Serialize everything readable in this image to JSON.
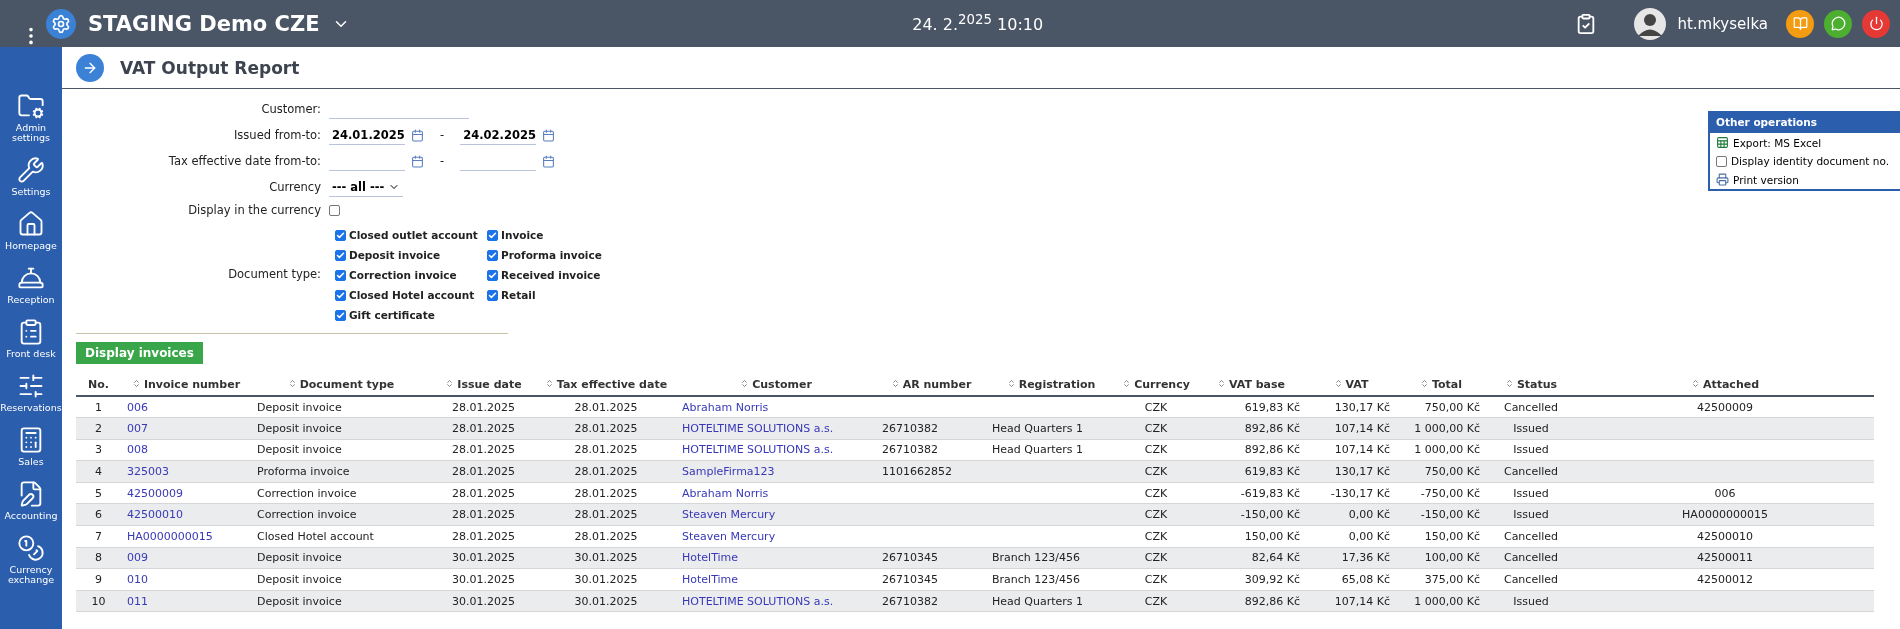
{
  "topbar": {
    "title": "STAGING Demo CZE",
    "datetime": "24. 2.$^{2025}$ 10:10",
    "user": "ht.mkyselka"
  },
  "sidebar": {
    "items": [
      {
        "label": "Admin settings"
      },
      {
        "label": "Settings"
      },
      {
        "label": "Homepage"
      },
      {
        "label": "Reception"
      },
      {
        "label": "Front desk"
      },
      {
        "label": "Reservations"
      },
      {
        "label": "Sales"
      },
      {
        "label": "Accounting"
      },
      {
        "label": "Currency exchange"
      }
    ]
  },
  "page": {
    "title": "VAT Output Report"
  },
  "form": {
    "customer_label": "Customer:",
    "issued_label": "Issued from-to:",
    "issued_from": "24.01.2025",
    "issued_to": "24.02.2025",
    "dash": "-",
    "tax_label": "Tax effective date from-to:",
    "currency_label": "Currency",
    "currency_value": "--- all ---",
    "display_currency_label": "Display in the currency",
    "display_currency_checked": false,
    "doc_type_label": "Document type:",
    "doc_types": [
      {
        "label": "Closed outlet account",
        "checked": true
      },
      {
        "label": "Invoice",
        "checked": true
      },
      {
        "label": "Deposit invoice",
        "checked": true
      },
      {
        "label": "Proforma invoice",
        "checked": true
      },
      {
        "label": "Correction invoice",
        "checked": true
      },
      {
        "label": "Received invoice",
        "checked": true
      },
      {
        "label": "Closed Hotel account",
        "checked": true
      },
      {
        "label": "Retail",
        "checked": true
      },
      {
        "label": "Gift certificate",
        "checked": true
      }
    ],
    "submit": "Display invoices"
  },
  "other_operations": {
    "title": "Other operations",
    "export": "Export: MS Excel",
    "identity_label": "Display identity document no.",
    "identity_checked": false,
    "print": "Print version"
  },
  "table": {
    "columns": [
      {
        "label": "No.",
        "sortable": false
      },
      {
        "label": "Invoice number",
        "sortable": true
      },
      {
        "label": "Document type",
        "sortable": true
      },
      {
        "label": "Issue date",
        "sortable": true
      },
      {
        "label": "Tax effective date",
        "sortable": true
      },
      {
        "label": "Customer",
        "sortable": true
      },
      {
        "label": "AR number",
        "sortable": true
      },
      {
        "label": "Registration",
        "sortable": true
      },
      {
        "label": "Currency",
        "sortable": true
      },
      {
        "label": "VAT base",
        "sortable": true
      },
      {
        "label": "VAT",
        "sortable": true
      },
      {
        "label": "Total",
        "sortable": true
      },
      {
        "label": "Status",
        "sortable": true
      },
      {
        "label": "Attached",
        "sortable": true
      }
    ],
    "rows": [
      [
        "1",
        "006",
        "Deposit invoice",
        "28.01.2025",
        "28.01.2025",
        "Abraham Norris",
        "",
        "",
        "CZK",
        "619,83 Kč",
        "130,17 Kč",
        "750,00 Kč",
        "Cancelled",
        "42500009"
      ],
      [
        "2",
        "007",
        "Deposit invoice",
        "28.01.2025",
        "28.01.2025",
        "HOTELTIME SOLUTIONS a.s.",
        "26710382",
        "Head Quarters 1",
        "CZK",
        "892,86 Kč",
        "107,14 Kč",
        "1 000,00 Kč",
        "Issued",
        ""
      ],
      [
        "3",
        "008",
        "Deposit invoice",
        "28.01.2025",
        "28.01.2025",
        "HOTELTIME SOLUTIONS a.s.",
        "26710382",
        "Head Quarters 1",
        "CZK",
        "892,86 Kč",
        "107,14 Kč",
        "1 000,00 Kč",
        "Issued",
        ""
      ],
      [
        "4",
        "325003",
        "Proforma invoice",
        "28.01.2025",
        "28.01.2025",
        "SampleFirma123",
        "1101662852",
        "",
        "CZK",
        "619,83 Kč",
        "130,17 Kč",
        "750,00 Kč",
        "Cancelled",
        ""
      ],
      [
        "5",
        "42500009",
        "Correction invoice",
        "28.01.2025",
        "28.01.2025",
        "Abraham Norris",
        "",
        "",
        "CZK",
        "-619,83 Kč",
        "-130,17 Kč",
        "-750,00 Kč",
        "Issued",
        "006"
      ],
      [
        "6",
        "42500010",
        "Correction invoice",
        "28.01.2025",
        "28.01.2025",
        "Steaven Mercury",
        "",
        "",
        "CZK",
        "-150,00 Kč",
        "0,00 Kč",
        "-150,00 Kč",
        "Issued",
        "HA0000000015"
      ],
      [
        "7",
        "HA0000000015",
        "Closed Hotel account",
        "28.01.2025",
        "28.01.2025",
        "Steaven Mercury",
        "",
        "",
        "CZK",
        "150,00 Kč",
        "0,00 Kč",
        "150,00 Kč",
        "Cancelled",
        "42500010"
      ],
      [
        "8",
        "009",
        "Deposit invoice",
        "30.01.2025",
        "30.01.2025",
        "HotelTime",
        "26710345",
        "Branch 123/456",
        "CZK",
        "82,64 Kč",
        "17,36 Kč",
        "100,00 Kč",
        "Cancelled",
        "42500011"
      ],
      [
        "9",
        "010",
        "Deposit invoice",
        "30.01.2025",
        "30.01.2025",
        "HotelTime",
        "26710345",
        "Branch 123/456",
        "CZK",
        "309,92 Kč",
        "65,08 Kč",
        "375,00 Kč",
        "Cancelled",
        "42500012"
      ],
      [
        "10",
        "011",
        "Deposit invoice",
        "30.01.2025",
        "30.01.2025",
        "HOTELTIME SOLUTIONS a.s.",
        "26710382",
        "Head Quarters 1",
        "CZK",
        "892,86 Kč",
        "107,14 Kč",
        "1 000,00 Kč",
        "Issued",
        ""
      ]
    ]
  }
}
